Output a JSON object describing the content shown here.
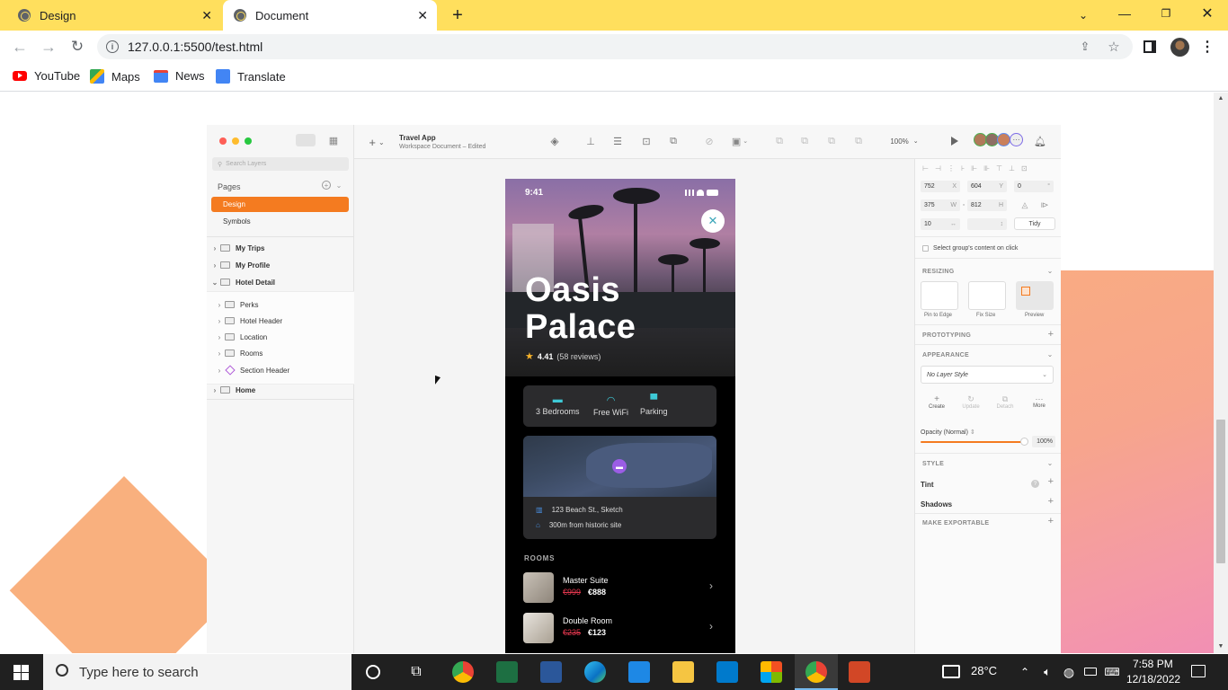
{
  "browser": {
    "tabs": [
      {
        "title": "Design",
        "active": false
      },
      {
        "title": "Document",
        "active": true
      }
    ],
    "url": "127.0.0.1:5500/test.html",
    "bookmarks": [
      "YouTube",
      "Maps",
      "News",
      "Translate"
    ],
    "colors": {
      "tabbar": "#ffdf5d"
    }
  },
  "app": {
    "document_title": "Travel App",
    "document_subtitle": "Workspace Document – Edited",
    "zoom": "100%",
    "search_placeholder": "Search Layers",
    "pages_label": "Pages",
    "pages": [
      "Design",
      "Symbols"
    ],
    "selected_page": "Design",
    "layers": [
      {
        "name": "My Trips",
        "bold": true
      },
      {
        "name": "My Profile",
        "bold": true
      },
      {
        "name": "Hotel Detail",
        "bold": true,
        "expanded": true
      },
      {
        "name": "Perks",
        "bold": false
      },
      {
        "name": "Hotel Header",
        "bold": false
      },
      {
        "name": "Location",
        "bold": false
      },
      {
        "name": "Rooms",
        "bold": false
      },
      {
        "name": "Section Header",
        "bold": false
      },
      {
        "name": "Home",
        "bold": true
      }
    ],
    "accent": "#f47b20"
  },
  "inspector": {
    "x": "752",
    "x_label": "X",
    "y": "604",
    "y_label": "Y",
    "rotation": "0",
    "rotation_unit": "°",
    "w": "375",
    "w_label": "W",
    "h": "812",
    "h_label": "H",
    "spacing": "10",
    "tidy": "Tidy",
    "select_group": "Select group's content on click",
    "resizing": "RESIZING",
    "resize_options": [
      "Pin to Edge",
      "Fix Size",
      "Preview"
    ],
    "prototyping": "PROTOTYPING",
    "appearance": "APPEARANCE",
    "layer_style": "No Layer Style",
    "style_actions": [
      "Create",
      "Update",
      "Detach",
      "More"
    ],
    "opacity_label": "Opacity (Normal)",
    "opacity_value": "100%",
    "style": "STYLE",
    "tint": "Tint",
    "shadows": "Shadows",
    "exportable": "MAKE EXPORTABLE"
  },
  "phone": {
    "time": "9:41",
    "hotel_name_line1": "Oasis",
    "hotel_name_line2": "Palace",
    "rating": "4.41",
    "reviews": "(58 reviews)",
    "amenities": [
      "3 Bedrooms",
      "Free WiFi",
      "Parking"
    ],
    "address": "123 Beach St., Sketch",
    "distance": "300m from historic site",
    "rooms_header": "ROOMS",
    "rooms": [
      {
        "name": "Master Suite",
        "old_price": "€999",
        "new_price": "€888"
      },
      {
        "name": "Double Room",
        "old_price": "€235",
        "new_price": "€123"
      }
    ]
  },
  "taskbar": {
    "search_placeholder": "Type here to search",
    "weather": "28°C",
    "time": "7:58 PM",
    "date": "12/18/2022"
  }
}
